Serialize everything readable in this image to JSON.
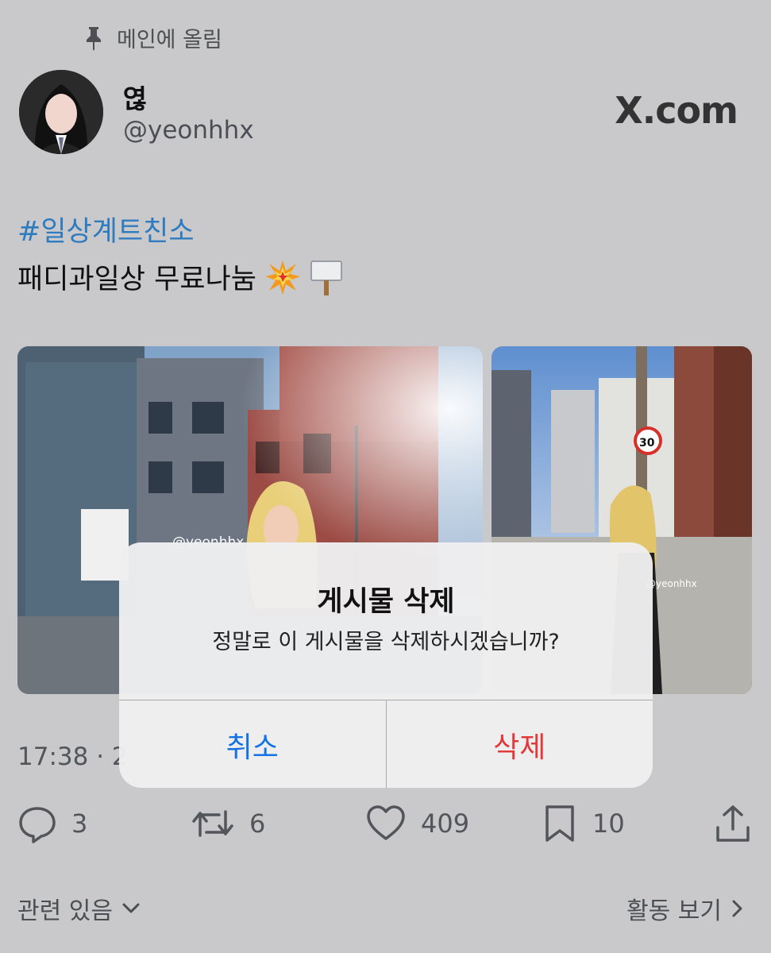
{
  "pinned": {
    "label": "메인에 올림"
  },
  "profile": {
    "display_name": "엲",
    "handle": "@yeonhhx"
  },
  "brand": {
    "text": "X.com"
  },
  "post": {
    "hashtag": "#일상계트친소",
    "text": "패디과일상 무료나눔",
    "emojis": [
      "collision-icon",
      "placard-icon"
    ],
    "timestamp": "17:38 · 2",
    "images": [
      {
        "watermark": "@yeonhhx",
        "sign": "30"
      },
      {
        "watermark": "@yeonhhx"
      }
    ]
  },
  "actions": {
    "replies": "3",
    "reposts": "6",
    "likes": "409",
    "bookmarks": "10"
  },
  "footer": {
    "left_label": "관련 있음",
    "right_label": "활동 보기"
  },
  "dialog": {
    "title": "게시물 삭제",
    "message": "정말로 이 게시물을 삭제하시겠습니까?",
    "cancel_label": "취소",
    "delete_label": "삭제"
  },
  "colors": {
    "background": "#c9c9cb",
    "link": "#2f7bc0",
    "cancel": "#1373e6",
    "destructive": "#e4393b"
  }
}
